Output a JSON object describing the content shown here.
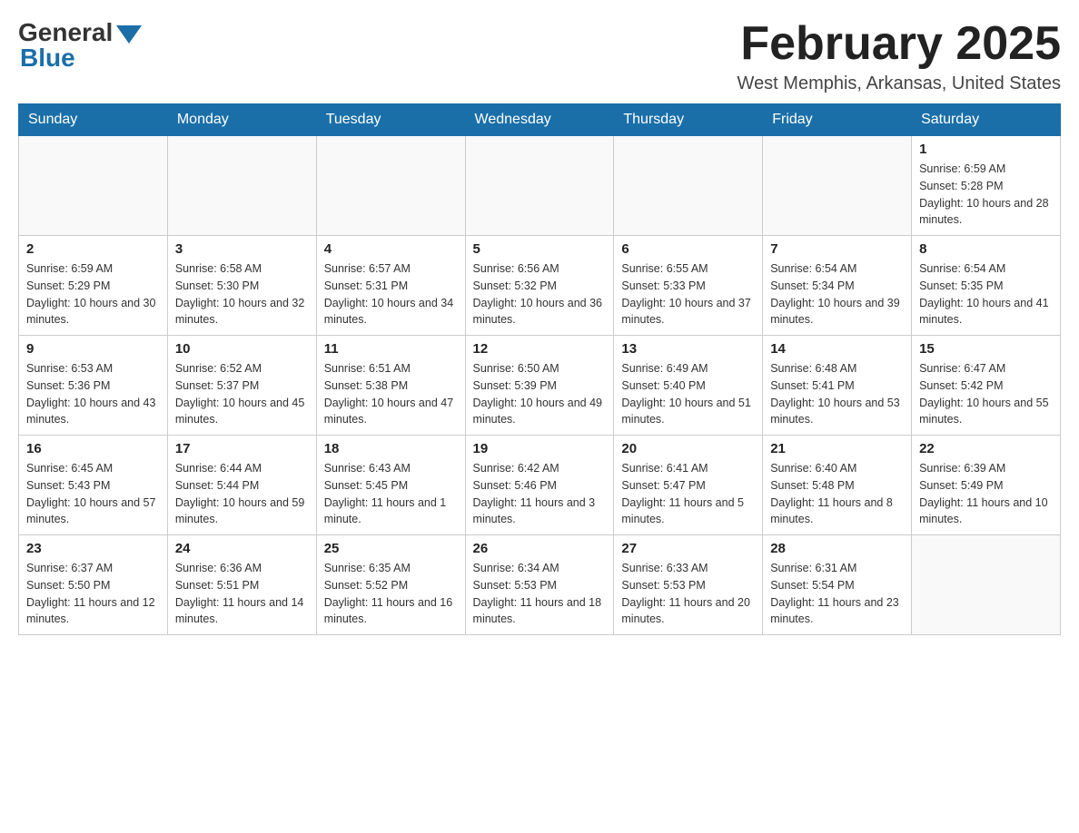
{
  "header": {
    "logo_general": "General",
    "logo_blue": "Blue",
    "month_title": "February 2025",
    "location": "West Memphis, Arkansas, United States"
  },
  "weekdays": [
    "Sunday",
    "Monday",
    "Tuesday",
    "Wednesday",
    "Thursday",
    "Friday",
    "Saturday"
  ],
  "weeks": [
    [
      {
        "day": "",
        "info": ""
      },
      {
        "day": "",
        "info": ""
      },
      {
        "day": "",
        "info": ""
      },
      {
        "day": "",
        "info": ""
      },
      {
        "day": "",
        "info": ""
      },
      {
        "day": "",
        "info": ""
      },
      {
        "day": "1",
        "info": "Sunrise: 6:59 AM\nSunset: 5:28 PM\nDaylight: 10 hours and 28 minutes."
      }
    ],
    [
      {
        "day": "2",
        "info": "Sunrise: 6:59 AM\nSunset: 5:29 PM\nDaylight: 10 hours and 30 minutes."
      },
      {
        "day": "3",
        "info": "Sunrise: 6:58 AM\nSunset: 5:30 PM\nDaylight: 10 hours and 32 minutes."
      },
      {
        "day": "4",
        "info": "Sunrise: 6:57 AM\nSunset: 5:31 PM\nDaylight: 10 hours and 34 minutes."
      },
      {
        "day": "5",
        "info": "Sunrise: 6:56 AM\nSunset: 5:32 PM\nDaylight: 10 hours and 36 minutes."
      },
      {
        "day": "6",
        "info": "Sunrise: 6:55 AM\nSunset: 5:33 PM\nDaylight: 10 hours and 37 minutes."
      },
      {
        "day": "7",
        "info": "Sunrise: 6:54 AM\nSunset: 5:34 PM\nDaylight: 10 hours and 39 minutes."
      },
      {
        "day": "8",
        "info": "Sunrise: 6:54 AM\nSunset: 5:35 PM\nDaylight: 10 hours and 41 minutes."
      }
    ],
    [
      {
        "day": "9",
        "info": "Sunrise: 6:53 AM\nSunset: 5:36 PM\nDaylight: 10 hours and 43 minutes."
      },
      {
        "day": "10",
        "info": "Sunrise: 6:52 AM\nSunset: 5:37 PM\nDaylight: 10 hours and 45 minutes."
      },
      {
        "day": "11",
        "info": "Sunrise: 6:51 AM\nSunset: 5:38 PM\nDaylight: 10 hours and 47 minutes."
      },
      {
        "day": "12",
        "info": "Sunrise: 6:50 AM\nSunset: 5:39 PM\nDaylight: 10 hours and 49 minutes."
      },
      {
        "day": "13",
        "info": "Sunrise: 6:49 AM\nSunset: 5:40 PM\nDaylight: 10 hours and 51 minutes."
      },
      {
        "day": "14",
        "info": "Sunrise: 6:48 AM\nSunset: 5:41 PM\nDaylight: 10 hours and 53 minutes."
      },
      {
        "day": "15",
        "info": "Sunrise: 6:47 AM\nSunset: 5:42 PM\nDaylight: 10 hours and 55 minutes."
      }
    ],
    [
      {
        "day": "16",
        "info": "Sunrise: 6:45 AM\nSunset: 5:43 PM\nDaylight: 10 hours and 57 minutes."
      },
      {
        "day": "17",
        "info": "Sunrise: 6:44 AM\nSunset: 5:44 PM\nDaylight: 10 hours and 59 minutes."
      },
      {
        "day": "18",
        "info": "Sunrise: 6:43 AM\nSunset: 5:45 PM\nDaylight: 11 hours and 1 minute."
      },
      {
        "day": "19",
        "info": "Sunrise: 6:42 AM\nSunset: 5:46 PM\nDaylight: 11 hours and 3 minutes."
      },
      {
        "day": "20",
        "info": "Sunrise: 6:41 AM\nSunset: 5:47 PM\nDaylight: 11 hours and 5 minutes."
      },
      {
        "day": "21",
        "info": "Sunrise: 6:40 AM\nSunset: 5:48 PM\nDaylight: 11 hours and 8 minutes."
      },
      {
        "day": "22",
        "info": "Sunrise: 6:39 AM\nSunset: 5:49 PM\nDaylight: 11 hours and 10 minutes."
      }
    ],
    [
      {
        "day": "23",
        "info": "Sunrise: 6:37 AM\nSunset: 5:50 PM\nDaylight: 11 hours and 12 minutes."
      },
      {
        "day": "24",
        "info": "Sunrise: 6:36 AM\nSunset: 5:51 PM\nDaylight: 11 hours and 14 minutes."
      },
      {
        "day": "25",
        "info": "Sunrise: 6:35 AM\nSunset: 5:52 PM\nDaylight: 11 hours and 16 minutes."
      },
      {
        "day": "26",
        "info": "Sunrise: 6:34 AM\nSunset: 5:53 PM\nDaylight: 11 hours and 18 minutes."
      },
      {
        "day": "27",
        "info": "Sunrise: 6:33 AM\nSunset: 5:53 PM\nDaylight: 11 hours and 20 minutes."
      },
      {
        "day": "28",
        "info": "Sunrise: 6:31 AM\nSunset: 5:54 PM\nDaylight: 11 hours and 23 minutes."
      },
      {
        "day": "",
        "info": ""
      }
    ]
  ]
}
